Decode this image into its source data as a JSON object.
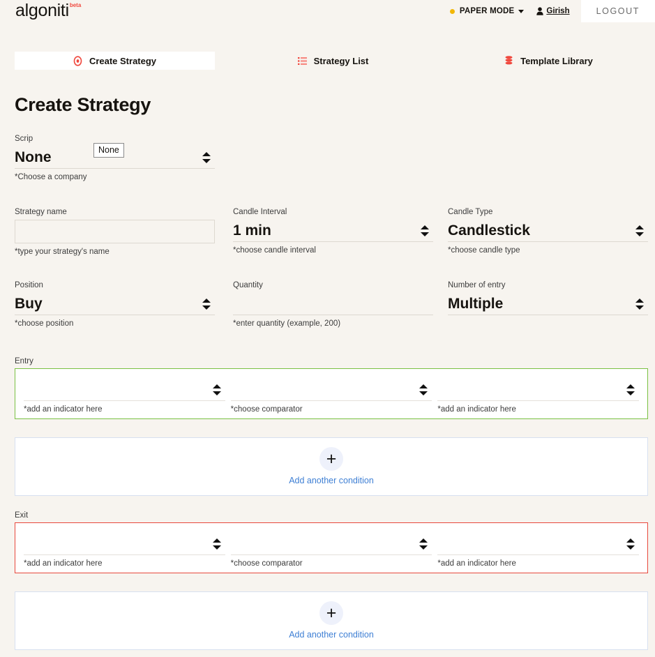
{
  "brand": {
    "name": "algoniti",
    "badge": "beta"
  },
  "header": {
    "paper_mode_label": "PAPER MODE",
    "status_dot_color": "#f2b705",
    "user_name": "Girish",
    "logout_label": "LOGOUT"
  },
  "tabs": [
    {
      "label": "Create Strategy",
      "icon": "target-icon",
      "active": true
    },
    {
      "label": "Strategy List",
      "icon": "list-icon",
      "active": false
    },
    {
      "label": "Template Library",
      "icon": "layers-icon",
      "active": false
    }
  ],
  "main": {
    "page_title": "Create Strategy",
    "scrip": {
      "label": "Scrip",
      "value": "None",
      "hint": "*Choose a company",
      "dropdown_open_option": "None"
    },
    "strategy_name": {
      "label": "Strategy name",
      "value": "",
      "placeholder": "",
      "hint": "*type your strategy's name"
    },
    "candle_interval": {
      "label": "Candle Interval",
      "value": "1 min",
      "hint": "*choose candle interval"
    },
    "candle_type": {
      "label": "Candle Type",
      "value": "Candlestick",
      "hint": "*choose candle type"
    },
    "position": {
      "label": "Position",
      "value": "Buy",
      "hint": "*choose position"
    },
    "quantity": {
      "label": "Quantity",
      "value": "",
      "placeholder": "",
      "hint": "*enter quantity (example, 200)"
    },
    "number_of_entry": {
      "label": "Number of entry",
      "value": "Multiple",
      "hint": ""
    },
    "entry": {
      "label": "Entry",
      "border_color": "#7ac143",
      "left_indicator": {
        "value": "",
        "hint": "*add an indicator here"
      },
      "comparator": {
        "value": "",
        "hint": "*choose comparator"
      },
      "right_indicator": {
        "value": "",
        "hint": "*add an indicator here"
      },
      "add_condition_label": "Add another condition"
    },
    "exit": {
      "label": "Exit",
      "border_color": "#e8483c",
      "left_indicator": {
        "value": "",
        "hint": "*add an indicator here"
      },
      "comparator": {
        "value": "",
        "hint": "*choose comparator"
      },
      "right_indicator": {
        "value": "",
        "hint": "*add an indicator here"
      },
      "add_condition_label": "Add another condition"
    }
  }
}
